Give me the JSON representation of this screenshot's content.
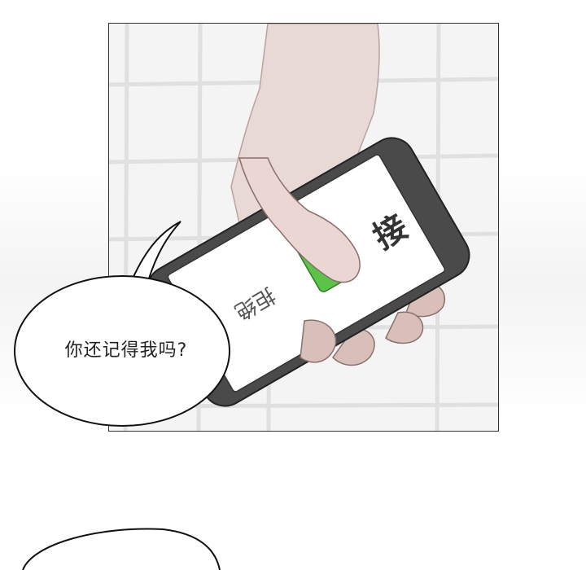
{
  "speech_bubble": {
    "text": "你还记得我吗?"
  },
  "phone": {
    "accept_label": "接",
    "decline_label": "拒绝",
    "accept_color": "#5cc24a",
    "body_color": "#4a4a4a"
  }
}
